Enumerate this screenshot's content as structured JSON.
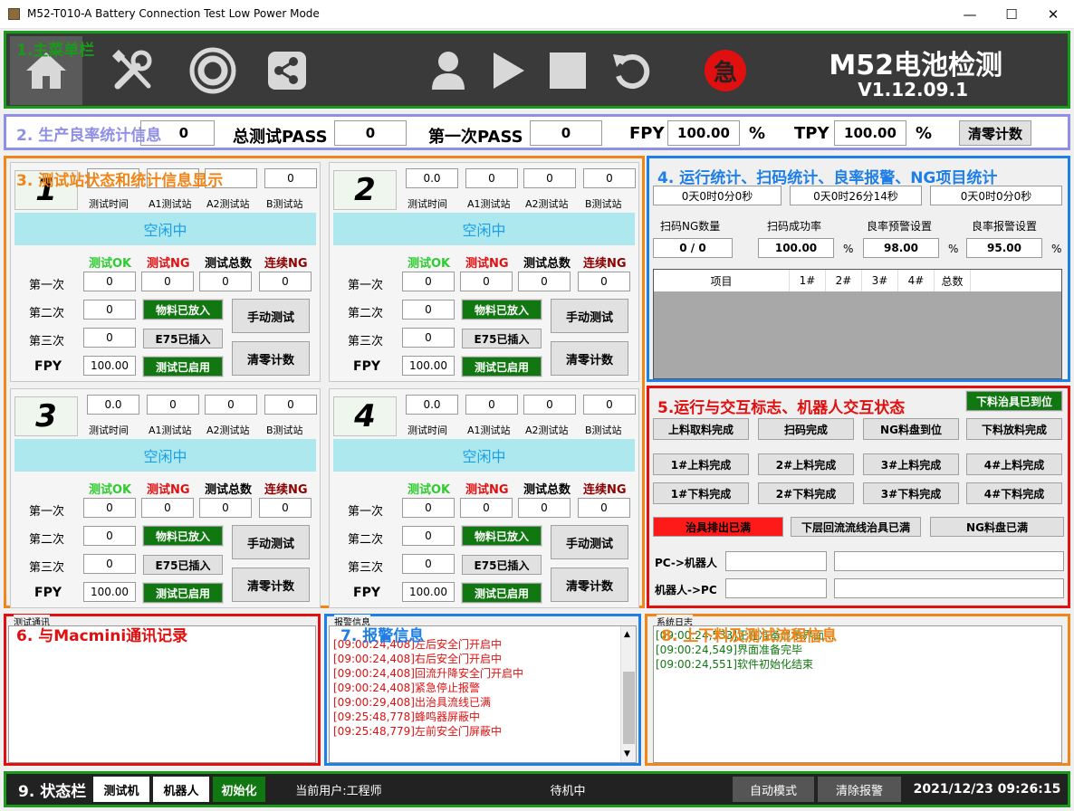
{
  "window": {
    "title": "M52-T010-A Battery Connection Test Low Power Mode",
    "min": "—",
    "max": "☐",
    "close": "✕"
  },
  "menu": {
    "label": "1.主菜单栏",
    "brand": "M52电池检测",
    "version": "V1.12.09.1",
    "emergency": "急",
    "buttons": [
      "home-icon",
      "tools-icon",
      "target-icon",
      "share-icon",
      "user-icon",
      "play-icon",
      "stop-icon",
      "reset-icon"
    ]
  },
  "yield": {
    "label": "2. 生产良率统计信息",
    "first_value": "0",
    "total_label": "总测试PASS",
    "total_value": "0",
    "first_pass_label": "第一次PASS",
    "first_pass_value": "0",
    "fpy_label": "FPY",
    "fpy_value": "100.00",
    "pct": "%",
    "tpy_label": "TPY",
    "tpy_value": "100.00",
    "pct2": "%",
    "clear_label": "清零计数"
  },
  "stations_label": "3. 测试站状态和统计信息显示",
  "station_common": {
    "head_labels": [
      "测试时间",
      "A1测试站",
      "A2测试站",
      "B测试站"
    ],
    "idle": "空闲中",
    "cols": [
      "测试OK",
      "测试NG",
      "测试总数",
      "连续NG"
    ],
    "rows": [
      "第一次",
      "第二次",
      "第三次"
    ],
    "fpy_label": "FPY",
    "btn_placed": "物料已放入",
    "btn_e75": "E75已插入",
    "btn_enabled": "测试已启用",
    "btn_manual": "手动测试",
    "btn_clear": "清零计数"
  },
  "stations": [
    {
      "num": "1",
      "head_values": [
        "",
        "",
        "",
        "0"
      ],
      "grid": [
        [
          "0",
          "0",
          "0",
          "0"
        ],
        [
          "0"
        ],
        [
          "0"
        ]
      ],
      "fpy": "100.00"
    },
    {
      "num": "2",
      "head_values": [
        "0.0",
        "0",
        "0",
        "0"
      ],
      "grid": [
        [
          "0",
          "0",
          "0",
          "0"
        ],
        [
          "0"
        ],
        [
          "0"
        ]
      ],
      "fpy": "100.00"
    },
    {
      "num": "3",
      "head_values": [
        "0.0",
        "0",
        "0",
        "0"
      ],
      "grid": [
        [
          "0",
          "0",
          "0",
          "0"
        ],
        [
          "0"
        ],
        [
          "0"
        ]
      ],
      "fpy": "100.00"
    },
    {
      "num": "4",
      "head_values": [
        "0.0",
        "0",
        "0",
        "0"
      ],
      "grid": [
        [
          "0",
          "0",
          "0",
          "0"
        ],
        [
          "0"
        ],
        [
          "0"
        ]
      ],
      "fpy": "100.00"
    }
  ],
  "stats": {
    "label": "4. 运行统计、扫码统计、良率报警、NG项目统计",
    "times": [
      "0天0时0分0秒",
      "0天0时26分14秒",
      "0天0时0分0秒"
    ],
    "scan_ng_label": "扫码NG数量",
    "scan_ng_value": "0 / 0",
    "scan_rate_label": "扫码成功率",
    "scan_rate_value": "100.00",
    "pct": "%",
    "warn_label": "良率预警设置",
    "warn_value": "98.00",
    "alarm_label": "良率报警设置",
    "alarm_value": "95.00",
    "table_headers": [
      "项目",
      "1#",
      "2#",
      "3#",
      "4#",
      "总数"
    ]
  },
  "robot": {
    "label": "5.运行与交互标志、机器人交互状态",
    "top_right": "下料治具已到位",
    "rows": [
      [
        "上料取料完成",
        "扫码完成",
        "NG料盘到位",
        "下料放料完成"
      ],
      [
        "1#上料完成",
        "2#上料完成",
        "3#上料完成",
        "4#上料完成"
      ],
      [
        "1#下料完成",
        "2#下料完成",
        "3#下料完成",
        "4#下料完成"
      ]
    ],
    "status_buttons": [
      "治具排出已满",
      "下层回流流线治具已满",
      "NG料盘已满"
    ],
    "pc_to_robot": "PC->机器人",
    "robot_to_pc": "机器人->PC"
  },
  "mac": {
    "label": "6. 与Macmini通讯记录",
    "title": "测试通讯"
  },
  "alarm": {
    "label": "7. 报警信息",
    "title": "报警信息",
    "lines": [
      "[09:00:24,408]左后安全门开启中",
      "[09:00:24,408]右后安全门开启中",
      "[09:00:24,408]回流升降安全门开启中",
      "[09:00:24,408]紧急停止报警",
      "[09:00:29,408]出治具流线已满",
      "[09:25:48,778]蜂鸣器屏蔽中",
      "[09:25:48,779]左前安全门屏蔽中"
    ]
  },
  "flow": {
    "label": "8. 上下料及测试流程信息",
    "title": "系统日志",
    "lines": [
      "[09:00:24,533]正在准备显示界面...",
      "[09:00:24,549]界面准备完毕",
      "[09:00:24,551]软件初始化结束"
    ]
  },
  "statusbar": {
    "label": "9. 状态栏",
    "test_machine": "测试机",
    "robot": "机器人",
    "init": "初始化",
    "user": "当前用户:工程师",
    "state": "待机中",
    "auto": "自动模式",
    "clear_alarm": "清除报警",
    "datetime": "2021/12/23 09:26:15"
  },
  "colors": {
    "menu_bg": "#3a3a3a",
    "green_frame": "#1a9a1a",
    "orange_frame": "#f0861a",
    "blue_frame": "#1f7fe6",
    "red_frame": "#e01010",
    "idle_bg": "#aee8ef",
    "ok_green": "#2ecc2e",
    "ng_red": "#e01010",
    "enabled_green": "#117711",
    "alarm_red": "#ff1a1a"
  }
}
